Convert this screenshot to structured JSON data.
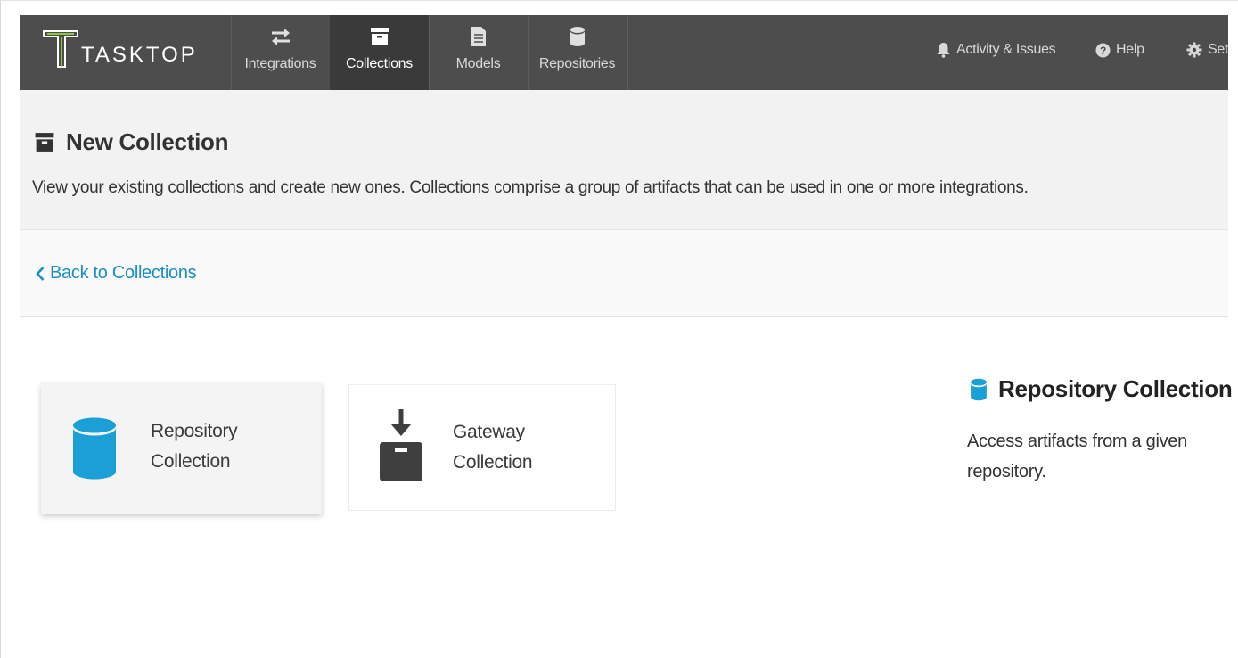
{
  "brand": {
    "name": "TASKTOP",
    "accent": "#8dc63f"
  },
  "nav": {
    "tabs": [
      {
        "label": "Integrations",
        "icon": "arrows-exchange-icon",
        "active": false
      },
      {
        "label": "Collections",
        "icon": "archive-box-icon",
        "active": true
      },
      {
        "label": "Models",
        "icon": "document-icon",
        "active": false
      },
      {
        "label": "Repositories",
        "icon": "database-icon",
        "active": false
      }
    ],
    "right": {
      "activity_label": "Activity & Issues",
      "help_label": "Help",
      "settings_label": "Set"
    }
  },
  "page": {
    "title": "New Collection",
    "description": "View your existing collections and create new ones. Collections comprise a group of artifacts that can be used in one or more integrations."
  },
  "back": {
    "label": "Back to Collections"
  },
  "cards": [
    {
      "line1": "Repository",
      "line2": "Collection",
      "icon": "database-icon",
      "selected": true
    },
    {
      "line1": "Gateway",
      "line2": "Collection",
      "icon": "inbox-download-icon",
      "selected": false
    }
  ],
  "detail": {
    "title": "Repository Collection",
    "description": "Access artifacts from a given repository."
  },
  "colors": {
    "topbar": "#4d4d4d",
    "active_tab": "#3a3a3a",
    "link": "#1a8fc4",
    "repository_icon": "#1a9fd6"
  }
}
